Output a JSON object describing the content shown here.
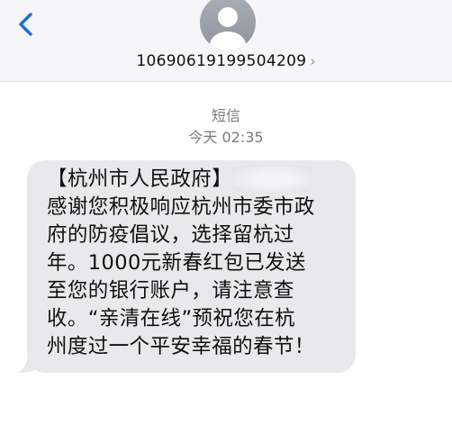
{
  "header": {
    "back_icon": "chevron-left-icon",
    "avatar_icon": "person-icon",
    "sender": "10690619199504209",
    "sender_chevron": "›"
  },
  "thread": {
    "message_kind": "短信",
    "timestamp": "今天 02:35"
  },
  "message": {
    "lines": [
      "【杭州市人民政府】",
      "感谢您积极响应杭州市委市政",
      "府的防疫倡议，选择留杭过",
      "年。1000元新春红包已发送",
      "至您的银行账户，请注意查",
      "收。“亲清在线”预祝您在杭",
      "州度过一个平安幸福的春节！"
    ],
    "bubble_color": "#e9e9eb"
  },
  "colors": {
    "accent": "#1a6fd6",
    "header_bg": "#f6f6f8"
  }
}
